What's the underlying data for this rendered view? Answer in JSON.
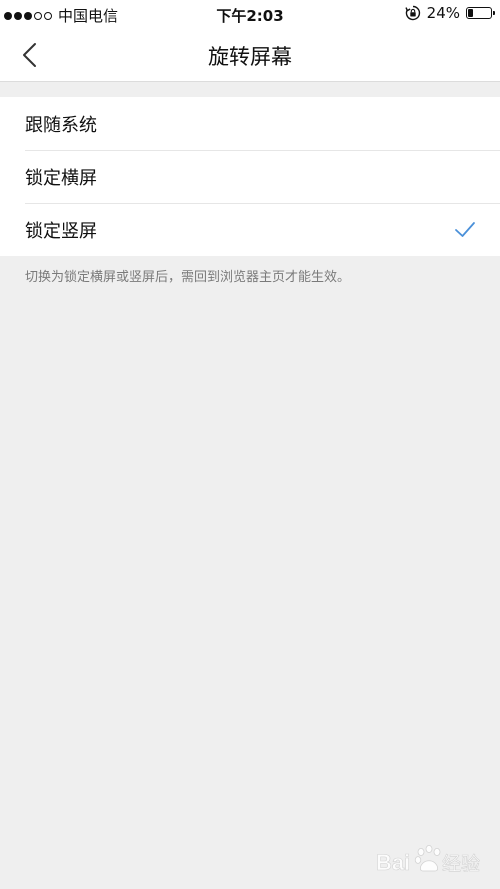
{
  "status_bar": {
    "signal_filled": 3,
    "signal_total": 5,
    "carrier": "中国电信",
    "time": "下午2:03",
    "battery_percent": "24%",
    "battery_level": 0.24
  },
  "nav": {
    "title": "旋转屏幕",
    "back_icon": "chevron-left-icon"
  },
  "options": [
    {
      "label": "跟随系统",
      "selected": false
    },
    {
      "label": "锁定横屏",
      "selected": false
    },
    {
      "label": "锁定竖屏",
      "selected": true
    }
  ],
  "hint": "切换为锁定横屏或竖屏后，需回到浏览器主页才能生效。",
  "colors": {
    "accent": "#4a90d9",
    "background": "#efefef",
    "surface": "#ffffff"
  },
  "watermark": "Bai经验"
}
